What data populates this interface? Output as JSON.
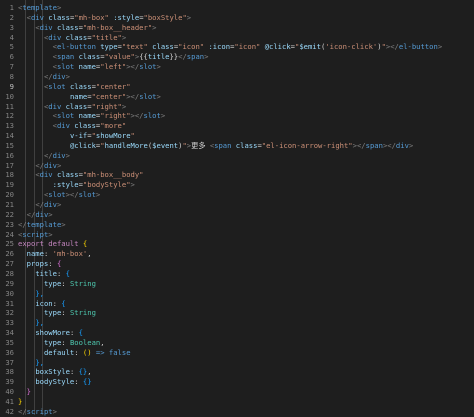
{
  "editor": {
    "colors": {
      "background": "#1e1e1e",
      "tag": "#569cd6",
      "attr": "#9cdcfe",
      "string": "#ce9178",
      "text": "#d4d4d4",
      "keyword": "#c586c0",
      "type": "#4ec9b0",
      "brace": "#ffd700",
      "punct": "#808080",
      "gutter": "#858585"
    },
    "lines": [
      {
        "n": "1",
        "t": [
          [
            "<",
            "p"
          ],
          [
            "template",
            "tag"
          ],
          [
            ">",
            "p"
          ]
        ]
      },
      {
        "n": "2",
        "t": [
          [
            "  ",
            "x"
          ],
          [
            "<",
            "p"
          ],
          [
            "div",
            "tag"
          ],
          [
            " ",
            "x"
          ],
          [
            "class",
            "attr"
          ],
          [
            "=",
            "x"
          ],
          [
            "\"mh-box\"",
            "str"
          ],
          [
            " ",
            "x"
          ],
          [
            ":style",
            "attr"
          ],
          [
            "=",
            "x"
          ],
          [
            "\"boxStyle\"",
            "str"
          ],
          [
            ">",
            "p"
          ]
        ]
      },
      {
        "n": "3",
        "t": [
          [
            "    ",
            "x"
          ],
          [
            "<",
            "p"
          ],
          [
            "div",
            "tag"
          ],
          [
            " ",
            "x"
          ],
          [
            "class",
            "attr"
          ],
          [
            "=",
            "x"
          ],
          [
            "\"mh-box__header\"",
            "str"
          ],
          [
            ">",
            "p"
          ]
        ]
      },
      {
        "n": "4",
        "t": [
          [
            "      ",
            "x"
          ],
          [
            "<",
            "p"
          ],
          [
            "div",
            "tag"
          ],
          [
            " ",
            "x"
          ],
          [
            "class",
            "attr"
          ],
          [
            "=",
            "x"
          ],
          [
            "\"title\"",
            "str"
          ],
          [
            ">",
            "p"
          ]
        ]
      },
      {
        "n": "5",
        "t": [
          [
            "        ",
            "x"
          ],
          [
            "<",
            "p"
          ],
          [
            "el-button",
            "tag"
          ],
          [
            " ",
            "x"
          ],
          [
            "type",
            "attr"
          ],
          [
            "=",
            "x"
          ],
          [
            "\"text\"",
            "str"
          ],
          [
            " ",
            "x"
          ],
          [
            "class",
            "attr"
          ],
          [
            "=",
            "x"
          ],
          [
            "\"icon\"",
            "str"
          ],
          [
            " ",
            "x"
          ],
          [
            ":icon",
            "attr"
          ],
          [
            "=",
            "x"
          ],
          [
            "\"icon\"",
            "str"
          ],
          [
            " ",
            "x"
          ],
          [
            "@click",
            "attr"
          ],
          [
            "=",
            "x"
          ],
          [
            "\"",
            "str"
          ],
          [
            "$emit",
            "attr"
          ],
          [
            "(",
            "x"
          ],
          [
            "'icon-click'",
            "str"
          ],
          [
            ")",
            "x"
          ],
          [
            "\"",
            "str"
          ],
          [
            "></",
            "p"
          ],
          [
            "el-button",
            "tag"
          ],
          [
            ">",
            "p"
          ]
        ]
      },
      {
        "n": "6",
        "t": [
          [
            "        ",
            "x"
          ],
          [
            "<",
            "p"
          ],
          [
            "span",
            "tag"
          ],
          [
            " ",
            "x"
          ],
          [
            "class",
            "attr"
          ],
          [
            "=",
            "x"
          ],
          [
            "\"value\"",
            "str"
          ],
          [
            ">",
            "p"
          ],
          [
            "{{",
            "x"
          ],
          [
            "title",
            "attr"
          ],
          [
            "}}",
            "x"
          ],
          [
            "</",
            "p"
          ],
          [
            "span",
            "tag"
          ],
          [
            ">",
            "p"
          ]
        ]
      },
      {
        "n": "7",
        "t": [
          [
            "        ",
            "x"
          ],
          [
            "<",
            "p"
          ],
          [
            "slot",
            "tag"
          ],
          [
            " ",
            "x"
          ],
          [
            "name",
            "attr"
          ],
          [
            "=",
            "x"
          ],
          [
            "\"left\"",
            "str"
          ],
          [
            "></",
            "p"
          ],
          [
            "slot",
            "tag"
          ],
          [
            ">",
            "p"
          ]
        ]
      },
      {
        "n": "8",
        "t": [
          [
            "      ",
            "x"
          ],
          [
            "</",
            "p"
          ],
          [
            "div",
            "tag"
          ],
          [
            ">",
            "p"
          ]
        ]
      },
      {
        "n": "9",
        "t": [
          [
            "      ",
            "x"
          ],
          [
            "<",
            "p"
          ],
          [
            "slot",
            "tag"
          ],
          [
            " ",
            "x"
          ],
          [
            "class",
            "attr"
          ],
          [
            "=",
            "x"
          ],
          [
            "\"center\"",
            "str"
          ]
        ]
      },
      {
        "n": "10",
        "t": [
          [
            "            ",
            "x"
          ],
          [
            "name",
            "attr"
          ],
          [
            "=",
            "x"
          ],
          [
            "\"center\"",
            "str"
          ],
          [
            "></",
            "p"
          ],
          [
            "slot",
            "tag"
          ],
          [
            ">",
            "p"
          ]
        ]
      },
      {
        "n": "11",
        "t": [
          [
            "      ",
            "x"
          ],
          [
            "<",
            "p"
          ],
          [
            "div",
            "tag"
          ],
          [
            " ",
            "x"
          ],
          [
            "class",
            "attr"
          ],
          [
            "=",
            "x"
          ],
          [
            "\"right\"",
            "str"
          ],
          [
            ">",
            "p"
          ]
        ]
      },
      {
        "n": "12",
        "t": [
          [
            "        ",
            "x"
          ],
          [
            "<",
            "p"
          ],
          [
            "slot",
            "tag"
          ],
          [
            " ",
            "x"
          ],
          [
            "name",
            "attr"
          ],
          [
            "=",
            "x"
          ],
          [
            "\"right\"",
            "str"
          ],
          [
            "></",
            "p"
          ],
          [
            "slot",
            "tag"
          ],
          [
            ">",
            "p"
          ]
        ]
      },
      {
        "n": "13",
        "t": [
          [
            "        ",
            "x"
          ],
          [
            "<",
            "p"
          ],
          [
            "div",
            "tag"
          ],
          [
            " ",
            "x"
          ],
          [
            "class",
            "attr"
          ],
          [
            "=",
            "x"
          ],
          [
            "\"more\"",
            "str"
          ]
        ]
      },
      {
        "n": "14",
        "t": [
          [
            "            ",
            "x"
          ],
          [
            "v-if",
            "attr"
          ],
          [
            "=",
            "x"
          ],
          [
            "\"",
            "str"
          ],
          [
            "showMore",
            "attr"
          ],
          [
            "\"",
            "str"
          ]
        ]
      },
      {
        "n": "15",
        "t": [
          [
            "            ",
            "x"
          ],
          [
            "@click",
            "attr"
          ],
          [
            "=",
            "x"
          ],
          [
            "\"",
            "str"
          ],
          [
            "handleMore",
            "attr"
          ],
          [
            "(",
            "x"
          ],
          [
            "$event",
            "attr"
          ],
          [
            ")",
            "x"
          ],
          [
            "\"",
            "str"
          ],
          [
            ">",
            "p"
          ],
          [
            "更多 ",
            "x"
          ],
          [
            "<",
            "p"
          ],
          [
            "span",
            "tag"
          ],
          [
            " ",
            "x"
          ],
          [
            "class",
            "attr"
          ],
          [
            "=",
            "x"
          ],
          [
            "\"el-icon-arrow-right\"",
            "str"
          ],
          [
            "></",
            "p"
          ],
          [
            "span",
            "tag"
          ],
          [
            "></",
            "p"
          ],
          [
            "div",
            "tag"
          ],
          [
            ">",
            "p"
          ]
        ]
      },
      {
        "n": "16",
        "t": [
          [
            "      ",
            "x"
          ],
          [
            "</",
            "p"
          ],
          [
            "div",
            "tag"
          ],
          [
            ">",
            "p"
          ]
        ]
      },
      {
        "n": "17",
        "t": [
          [
            "    ",
            "x"
          ],
          [
            "</",
            "p"
          ],
          [
            "div",
            "tag"
          ],
          [
            ">",
            "p"
          ]
        ]
      },
      {
        "n": "18",
        "t": [
          [
            "    ",
            "x"
          ],
          [
            "<",
            "p"
          ],
          [
            "div",
            "tag"
          ],
          [
            " ",
            "x"
          ],
          [
            "class",
            "attr"
          ],
          [
            "=",
            "x"
          ],
          [
            "\"mh-box__body\"",
            "str"
          ]
        ]
      },
      {
        "n": "19",
        "t": [
          [
            "        ",
            "x"
          ],
          [
            ":style",
            "attr"
          ],
          [
            "=",
            "x"
          ],
          [
            "\"bodyStyle\"",
            "str"
          ],
          [
            ">",
            "p"
          ]
        ]
      },
      {
        "n": "20",
        "t": [
          [
            "      ",
            "x"
          ],
          [
            "<",
            "p"
          ],
          [
            "slot",
            "tag"
          ],
          [
            "></",
            "p"
          ],
          [
            "slot",
            "tag"
          ],
          [
            ">",
            "p"
          ]
        ]
      },
      {
        "n": "21",
        "t": [
          [
            "    ",
            "x"
          ],
          [
            "</",
            "p"
          ],
          [
            "div",
            "tag"
          ],
          [
            ">",
            "p"
          ]
        ]
      },
      {
        "n": "22",
        "t": [
          [
            "  ",
            "x"
          ],
          [
            "</",
            "p"
          ],
          [
            "div",
            "tag"
          ],
          [
            ">",
            "p"
          ]
        ]
      },
      {
        "n": "23",
        "t": [
          [
            "</",
            "p"
          ],
          [
            "template",
            "tag"
          ],
          [
            ">",
            "p"
          ]
        ]
      },
      {
        "n": "24",
        "t": [
          [
            "<",
            "p"
          ],
          [
            "script",
            "tag"
          ],
          [
            ">",
            "p"
          ]
        ]
      },
      {
        "n": "25",
        "t": [
          [
            "export",
            "kw"
          ],
          [
            " ",
            "x"
          ],
          [
            "default",
            "kw"
          ],
          [
            " ",
            "x"
          ],
          [
            "{",
            "br"
          ]
        ]
      },
      {
        "n": "26",
        "t": [
          [
            "  ",
            "x"
          ],
          [
            "name",
            "attr"
          ],
          [
            ": ",
            "x"
          ],
          [
            "'mh-box'",
            "str"
          ],
          [
            ",",
            "x"
          ]
        ]
      },
      {
        "n": "27",
        "t": [
          [
            "  ",
            "x"
          ],
          [
            "props",
            "attr"
          ],
          [
            ": ",
            "x"
          ],
          [
            "{",
            "br2"
          ]
        ]
      },
      {
        "n": "28",
        "t": [
          [
            "    ",
            "x"
          ],
          [
            "title",
            "attr"
          ],
          [
            ": ",
            "x"
          ],
          [
            "{",
            "br3"
          ]
        ]
      },
      {
        "n": "29",
        "t": [
          [
            "      ",
            "x"
          ],
          [
            "type",
            "attr"
          ],
          [
            ": ",
            "x"
          ],
          [
            "String",
            "ty"
          ]
        ]
      },
      {
        "n": "30",
        "t": [
          [
            "    ",
            "x"
          ],
          [
            "},",
            "br3"
          ]
        ]
      },
      {
        "n": "31",
        "t": [
          [
            "    ",
            "x"
          ],
          [
            "icon",
            "attr"
          ],
          [
            ": ",
            "x"
          ],
          [
            "{",
            "br3"
          ]
        ]
      },
      {
        "n": "32",
        "t": [
          [
            "      ",
            "x"
          ],
          [
            "type",
            "attr"
          ],
          [
            ": ",
            "x"
          ],
          [
            "String",
            "ty"
          ]
        ]
      },
      {
        "n": "33",
        "t": [
          [
            "    ",
            "x"
          ],
          [
            "},",
            "br3"
          ]
        ]
      },
      {
        "n": "34",
        "t": [
          [
            "    ",
            "x"
          ],
          [
            "showMore",
            "attr"
          ],
          [
            ": ",
            "x"
          ],
          [
            "{",
            "br3"
          ]
        ]
      },
      {
        "n": "35",
        "t": [
          [
            "      ",
            "x"
          ],
          [
            "type",
            "attr"
          ],
          [
            ": ",
            "x"
          ],
          [
            "Boolean",
            "ty"
          ],
          [
            ",",
            "x"
          ]
        ]
      },
      {
        "n": "36",
        "t": [
          [
            "      ",
            "x"
          ],
          [
            "default",
            "attr"
          ],
          [
            ": ",
            "x"
          ],
          [
            "()",
            "br"
          ],
          [
            " => ",
            "tag"
          ],
          [
            "false",
            "tag"
          ]
        ]
      },
      {
        "n": "37",
        "t": [
          [
            "    ",
            "x"
          ],
          [
            "},",
            "br3"
          ]
        ]
      },
      {
        "n": "38",
        "t": [
          [
            "    ",
            "x"
          ],
          [
            "boxStyle",
            "attr"
          ],
          [
            ": ",
            "x"
          ],
          [
            "{}",
            "br3"
          ],
          [
            ",",
            "x"
          ]
        ]
      },
      {
        "n": "39",
        "t": [
          [
            "    ",
            "x"
          ],
          [
            "bodyStyle",
            "attr"
          ],
          [
            ": ",
            "x"
          ],
          [
            "{}",
            "br3"
          ]
        ]
      },
      {
        "n": "40",
        "t": [
          [
            "  ",
            "x"
          ],
          [
            "}",
            "br2"
          ]
        ]
      },
      {
        "n": "41",
        "t": [
          [
            "}",
            "br"
          ]
        ]
      },
      {
        "n": "42",
        "t": [
          [
            "</",
            "p"
          ],
          [
            "script",
            "tag"
          ],
          [
            ">",
            "p"
          ]
        ]
      }
    ]
  }
}
